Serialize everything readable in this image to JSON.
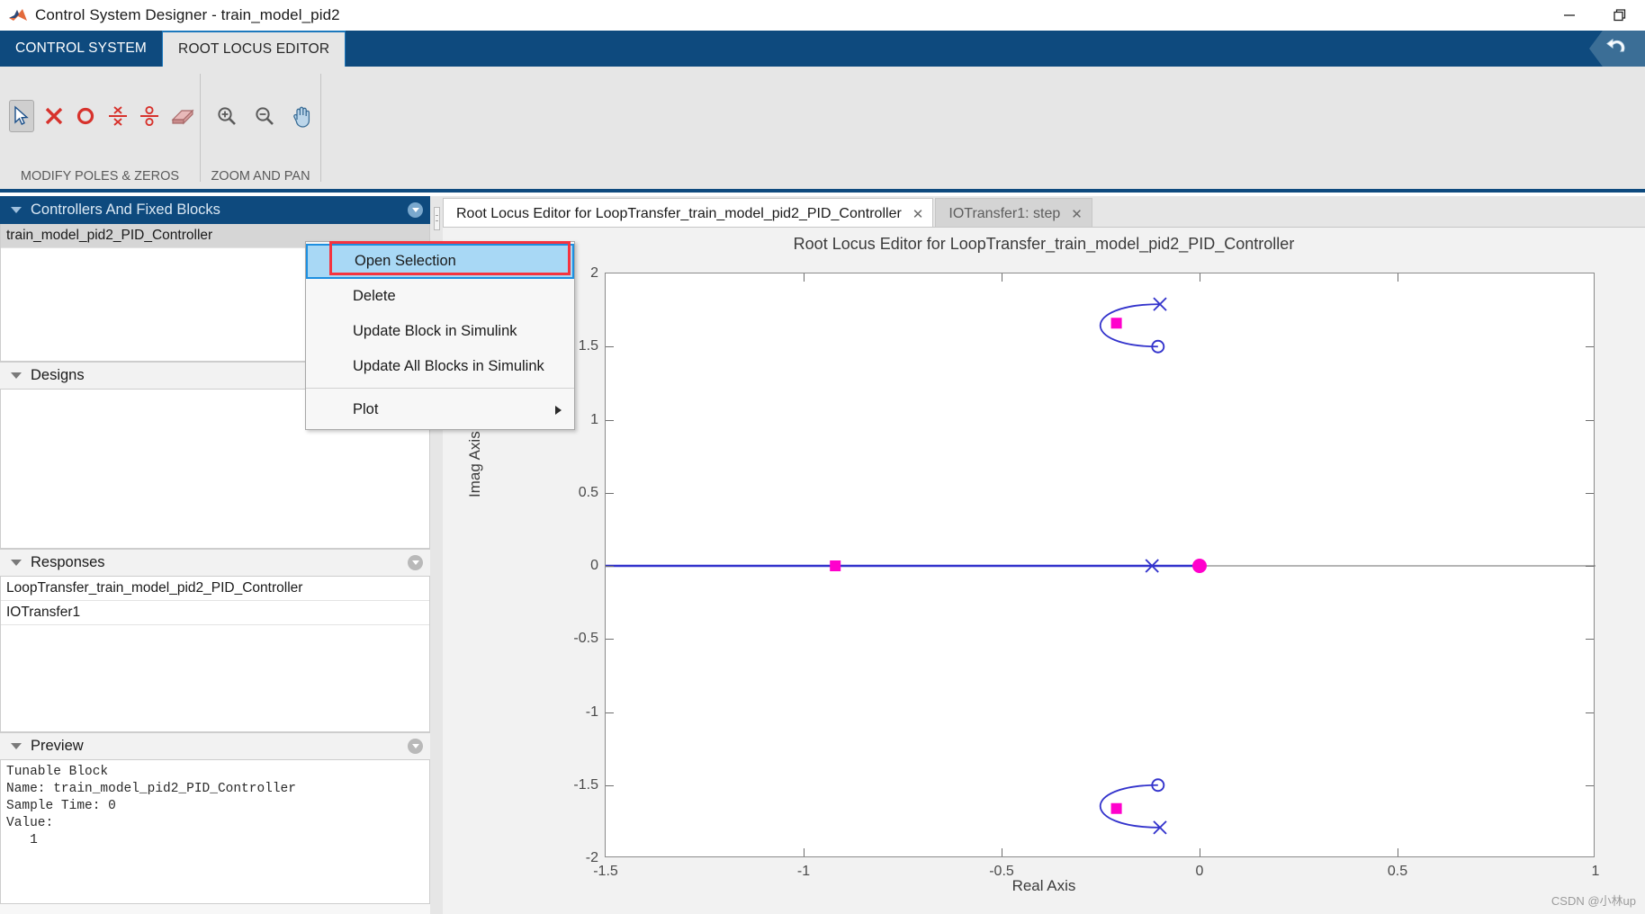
{
  "window": {
    "title": "Control System Designer - train_model_pid2",
    "logo_icon": "matlab-logo-icon",
    "minimize_label": "—",
    "restore_label": "❐",
    "close_label": "✕"
  },
  "ribbon": {
    "tabs": [
      {
        "label": "CONTROL SYSTEM",
        "active": false
      },
      {
        "label": "ROOT LOCUS EDITOR",
        "active": true
      }
    ],
    "undo_icon": "undo-arrow-icon",
    "groups": [
      {
        "label": "MODIFY POLES & ZEROS",
        "tools": [
          {
            "icon": "pointer-arrow-icon",
            "selected": true
          },
          {
            "icon": "add-real-pole-icon",
            "selected": false
          },
          {
            "icon": "add-real-zero-icon",
            "selected": false
          },
          {
            "icon": "add-complex-pole-pair-icon",
            "selected": false
          },
          {
            "icon": "add-complex-zero-pair-icon",
            "selected": false
          },
          {
            "icon": "eraser-delete-icon",
            "selected": false
          }
        ]
      },
      {
        "label": "ZOOM AND PAN",
        "tools": [
          {
            "icon": "zoom-in-icon",
            "selected": false
          },
          {
            "icon": "zoom-out-icon",
            "selected": false
          },
          {
            "icon": "pan-hand-icon",
            "selected": false
          }
        ]
      }
    ]
  },
  "sidebar": {
    "controllers": {
      "title": "Controllers And Fixed Blocks",
      "items": [
        {
          "label": "train_model_pid2_PID_Controller",
          "selected": true
        }
      ]
    },
    "designs": {
      "title": "Designs",
      "items": []
    },
    "responses": {
      "title": "Responses",
      "items": [
        {
          "label": "LoopTransfer_train_model_pid2_PID_Controller",
          "selected": false
        },
        {
          "label": "IOTransfer1",
          "selected": false
        }
      ]
    },
    "preview": {
      "title": "Preview",
      "text": "Tunable Block\nName: train_model_pid2_PID_Controller\nSample Time: 0\nValue:\n   1"
    }
  },
  "context_menu": {
    "items": [
      {
        "label": "Open Selection",
        "highlighted": true,
        "submenu": false
      },
      {
        "label": "Delete",
        "highlighted": false,
        "submenu": false
      },
      {
        "label": "Update Block in Simulink",
        "highlighted": false,
        "submenu": false
      },
      {
        "label": "Update All Blocks in Simulink",
        "highlighted": false,
        "submenu": false
      },
      {
        "separator": true
      },
      {
        "label": "Plot",
        "highlighted": false,
        "submenu": true
      }
    ],
    "annotation_color": "#f5333f"
  },
  "doc_tabs": [
    {
      "label": "Root Locus Editor for LoopTransfer_train_model_pid2_PID_Controller",
      "active": true,
      "close_label": "✕"
    },
    {
      "label": "IOTransfer1: step",
      "active": false,
      "close_label": "✕"
    }
  ],
  "chart_data": {
    "type": "scatter",
    "title": "Root Locus Editor for LoopTransfer_train_model_pid2_PID_Controller",
    "xlabel": "Real Axis",
    "ylabel": "Imag Axis",
    "xlim": [
      -1.5,
      1
    ],
    "ylim": [
      -2,
      2
    ],
    "xticks": [
      -1.5,
      -1,
      -0.5,
      0,
      0.5,
      1
    ],
    "xticklabels": [
      "-1.5",
      "-1",
      "-0.5",
      "0",
      "0.5",
      "1"
    ],
    "yticks": [
      -2,
      -1.5,
      -1,
      -0.5,
      0,
      0.5,
      1,
      1.5,
      2
    ],
    "yticklabels": [
      "-2",
      "-1.5",
      "-1",
      "-0.5",
      "0",
      "0.5",
      "1",
      "1.5",
      "2"
    ],
    "grid": false,
    "legend": "none",
    "locus_color": "#3333cc",
    "closed_loop_pole_color": "#ff00cc",
    "series": [
      {
        "name": "open-loop poles",
        "marker": "x",
        "color": "#3333cc",
        "points": [
          {
            "x": -0.12,
            "y": 0.0
          },
          {
            "x": -0.1,
            "y": 1.79
          },
          {
            "x": -0.1,
            "y": -1.79
          }
        ]
      },
      {
        "name": "open-loop zeros",
        "marker": "o",
        "color": "#3333cc",
        "points": [
          {
            "x": -0.105,
            "y": 1.5
          },
          {
            "x": -0.105,
            "y": -1.5
          }
        ]
      },
      {
        "name": "closed-loop poles",
        "marker": "square",
        "color": "#ff00cc",
        "points": [
          {
            "x": -0.92,
            "y": 0.0
          },
          {
            "x": -0.21,
            "y": 1.66
          },
          {
            "x": -0.21,
            "y": -1.66
          }
        ]
      },
      {
        "name": "integrator pole at origin",
        "marker": "filled-circle",
        "color": "#ff00cc",
        "points": [
          {
            "x": 0.0,
            "y": 0.0
          }
        ]
      }
    ],
    "branches": [
      {
        "name": "real-axis-branch",
        "from": {
          "x": -1.5,
          "y": 0
        },
        "to": {
          "x": 0.0,
          "y": 0
        }
      },
      {
        "name": "upper-complex-branch",
        "from": {
          "x": -0.1,
          "y": 1.79
        },
        "to": {
          "x": -0.105,
          "y": 1.5
        },
        "apex": {
          "x": -0.3,
          "y": 1.64
        }
      },
      {
        "name": "lower-complex-branch",
        "from": {
          "x": -0.1,
          "y": -1.79
        },
        "to": {
          "x": -0.105,
          "y": -1.5
        },
        "apex": {
          "x": -0.3,
          "y": -1.64
        }
      }
    ],
    "watermark": "CSDN @小林up"
  }
}
